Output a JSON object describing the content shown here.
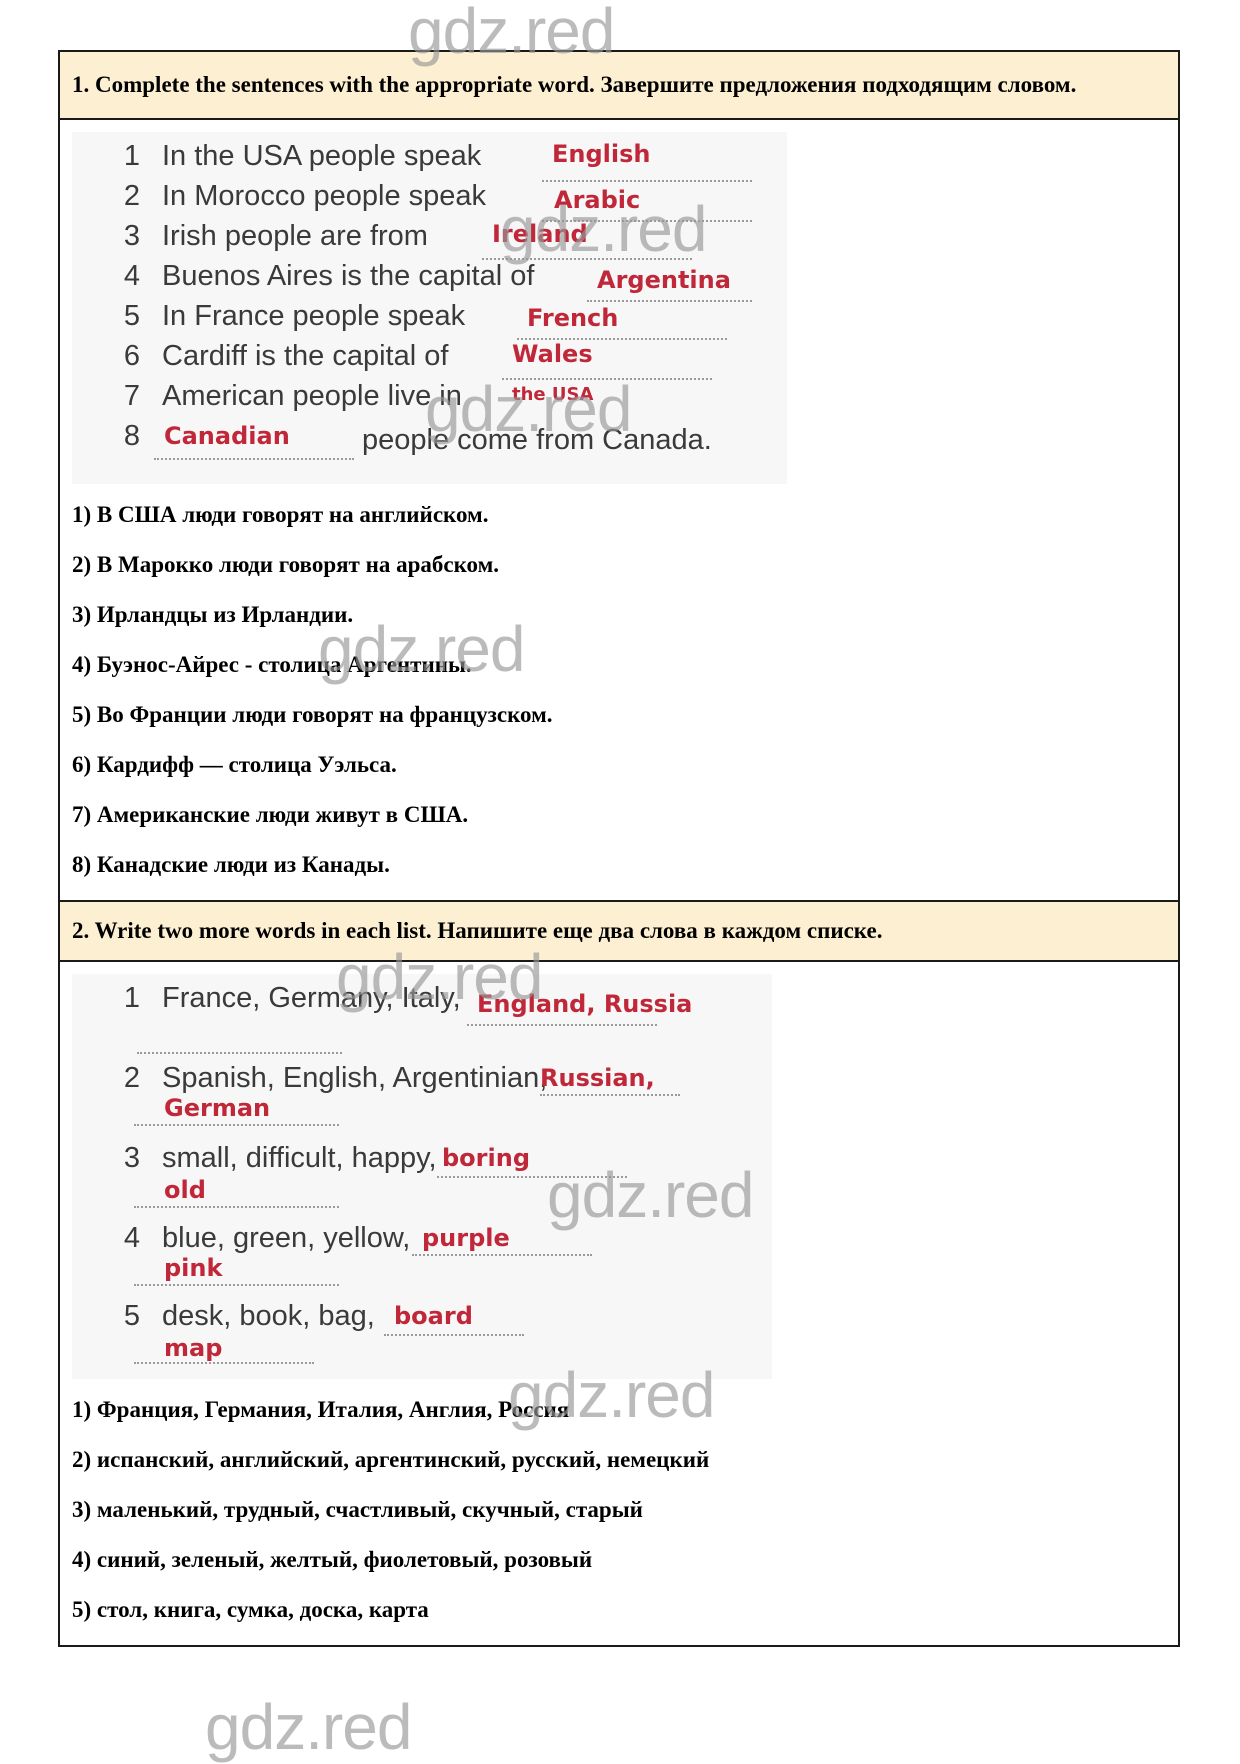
{
  "watermark": "gdz.red",
  "task1": {
    "header": "1. Complete the sentences with the appropriate word. Завершите предложения подходящим словом.",
    "exercise": [
      {
        "n": "1",
        "text": "In the USA people speak",
        "answer": "English",
        "end": "."
      },
      {
        "n": "2",
        "text": "In Morocco people speak",
        "answer": "Arabic",
        "end": "."
      },
      {
        "n": "3",
        "text": "Irish people are from",
        "answer": "Ireland",
        "end": "."
      },
      {
        "n": "4",
        "text": "Buenos Aires is the capital of",
        "answer": "Argentina",
        "end": "."
      },
      {
        "n": "5",
        "text": "In France people speak",
        "answer": "French",
        "end": "."
      },
      {
        "n": "6",
        "text": "Cardiff is the capital of",
        "answer": "Wales",
        "end": "."
      },
      {
        "n": "7",
        "text": "American people live in",
        "answer": "the USA",
        "end": ""
      },
      {
        "n": "8",
        "text": "people come from Canada.",
        "answer": "Canadian",
        "end": ""
      }
    ],
    "translations": [
      "1) В США люди говорят на английском.",
      "2) В Марокко люди говорят на арабском.",
      "3) Ирландцы из Ирландии.",
      "4) Буэнос-Айрес - столица Аргентины.",
      "5) Во Франции люди говорят  на французском.",
      "6) Кардифф — столица Уэльса.",
      "7) Американские люди живут в США.",
      "8) Канадские люди из Канады."
    ]
  },
  "task2": {
    "header": "2. Write two more words in each list. Напишите еще два слова в каждом списке.",
    "exercise": [
      {
        "n": "1",
        "text": "France, Germany, Italy,",
        "answer1": "England, Russia",
        "answer2": ""
      },
      {
        "n": "2",
        "text": "Spanish, English, Argentinian,",
        "answer1": "Russian,",
        "answer2": "German"
      },
      {
        "n": "3",
        "text": "small, difficult, happy,",
        "answer1": "boring",
        "answer2": "old"
      },
      {
        "n": "4",
        "text": "blue, green, yellow,",
        "answer1": "purple",
        "answer2": "pink"
      },
      {
        "n": "5",
        "text": "desk, book, bag,",
        "answer1": "board",
        "answer2": "map"
      }
    ],
    "translations": [
      "1) Франция, Германия, Италия, Англия, Россия",
      "2) испанский, английский, аргентинский, русский, немецкий",
      "3) маленький, трудный, счастливый, скучный, старый",
      "4) синий, зеленый, желтый, фиолетовый, розовый",
      "5) стол, книга, сумка, доска, карта"
    ]
  }
}
